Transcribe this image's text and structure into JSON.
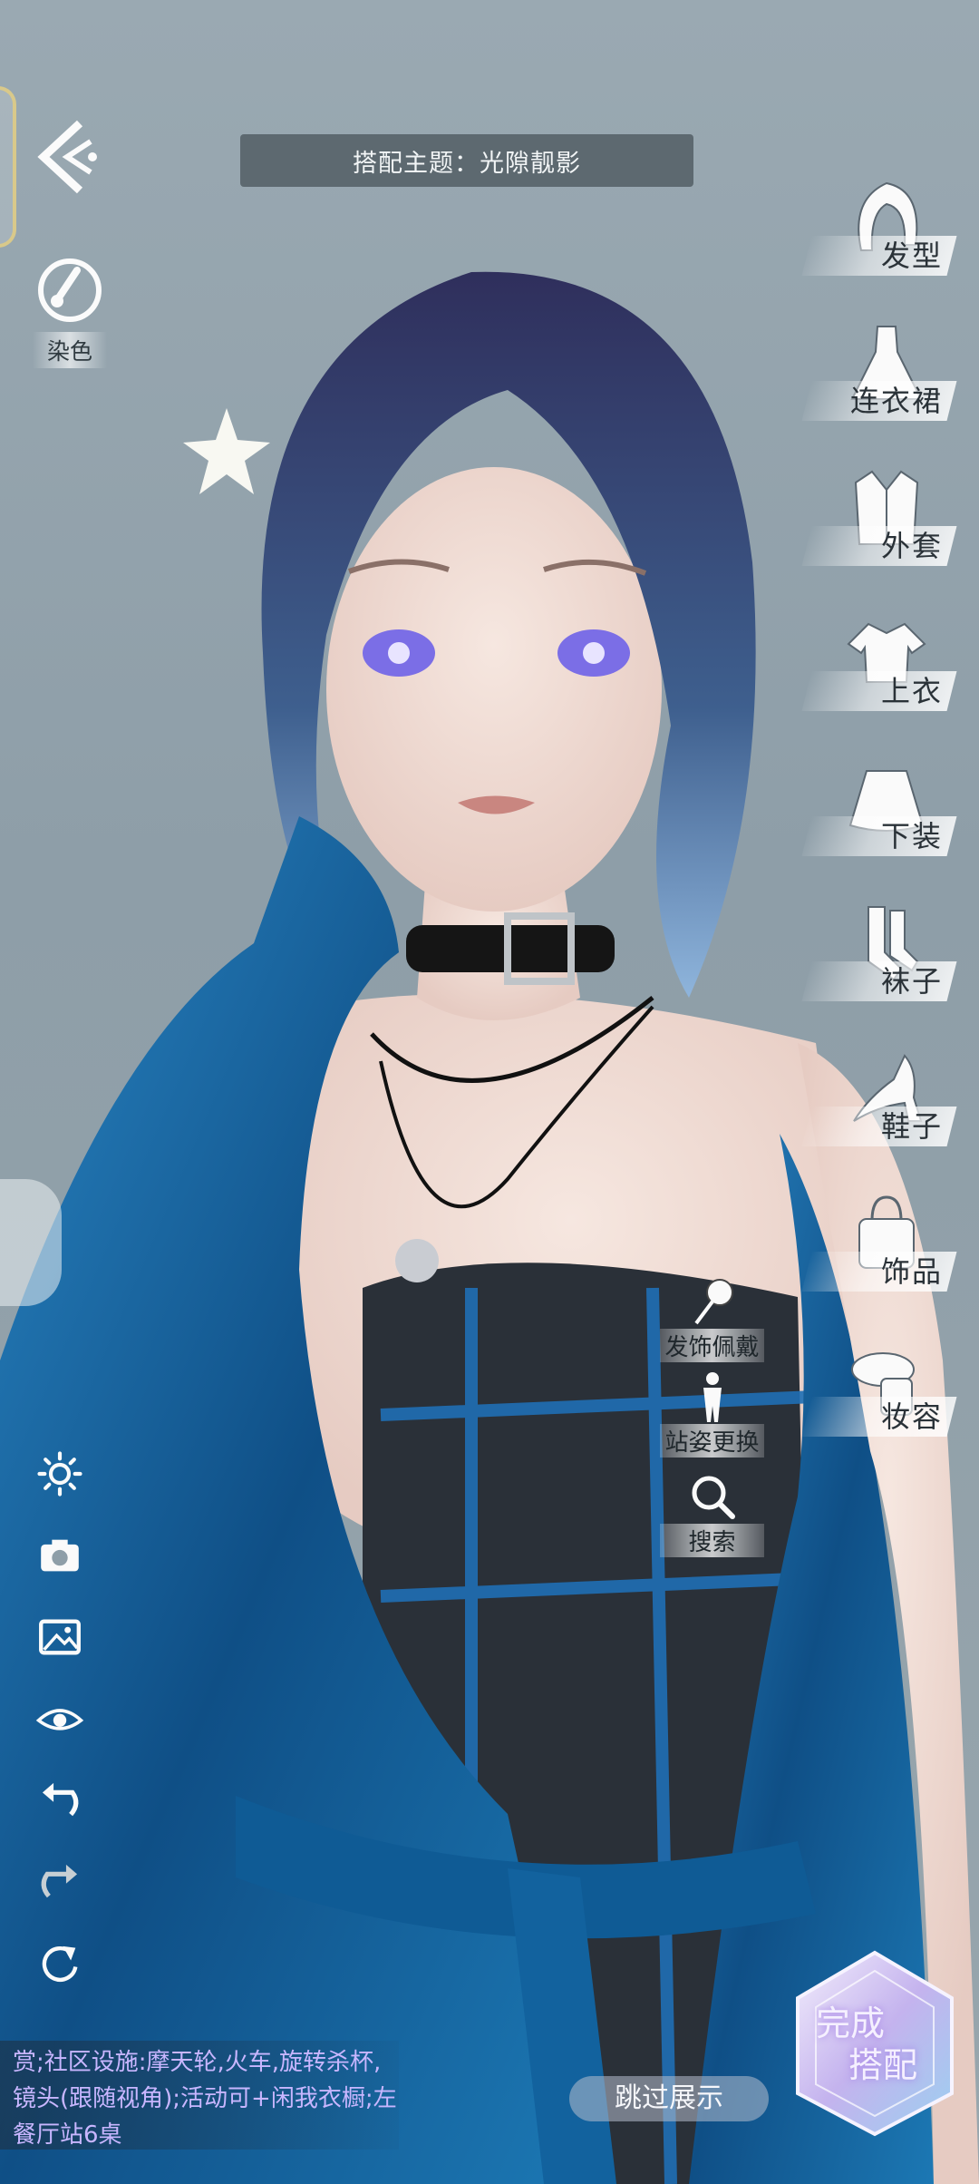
{
  "theme_bar": {
    "text": "搭配主题：光隙靓影"
  },
  "dye": {
    "label": "染色"
  },
  "categories": [
    {
      "label": "发型",
      "icon": "hair-icon"
    },
    {
      "label": "连衣裙",
      "icon": "dress-icon"
    },
    {
      "label": "外套",
      "icon": "coat-icon"
    },
    {
      "label": "上衣",
      "icon": "top-icon"
    },
    {
      "label": "下装",
      "icon": "skirt-icon"
    },
    {
      "label": "袜子",
      "icon": "socks-icon"
    },
    {
      "label": "鞋子",
      "icon": "heel-shoe-icon"
    },
    {
      "label": "饰品",
      "icon": "bag-icon"
    },
    {
      "label": "妆容",
      "icon": "makeup-icon"
    }
  ],
  "mini_tools": [
    {
      "label": "发饰佩戴",
      "icon": "hair-ornament-icon"
    },
    {
      "label": "站姿更换",
      "icon": "pose-icon"
    },
    {
      "label": "搜索",
      "icon": "search-icon"
    }
  ],
  "notice": {
    "text": "赏;社区设施:摩天轮,火车,旋转杀杯,镜头(跟随视角);活动可+闲我衣橱;左餐厅站6桌"
  },
  "skip": {
    "label": "跳过展示"
  },
  "finish": {
    "line1": "完成",
    "line2": "搭配"
  },
  "colors": {
    "accent_purple": "#c8b6ff",
    "bar_bg": "#505c62",
    "coat_blue": "#1e6fa8"
  }
}
